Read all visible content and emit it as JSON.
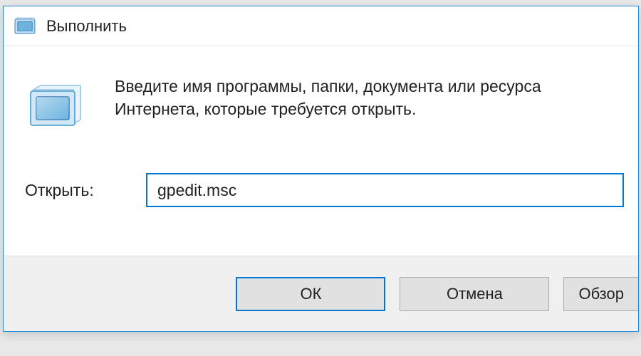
{
  "dialog": {
    "title": "Выполнить",
    "description": "Введите имя программы, папки, документа или ресурса Интернета, которые требуется открыть.",
    "open_label": "Открыть:",
    "input_value": "gpedit.msc",
    "buttons": {
      "ok": "ОК",
      "cancel": "Отмена",
      "browse": "Обзор"
    }
  }
}
